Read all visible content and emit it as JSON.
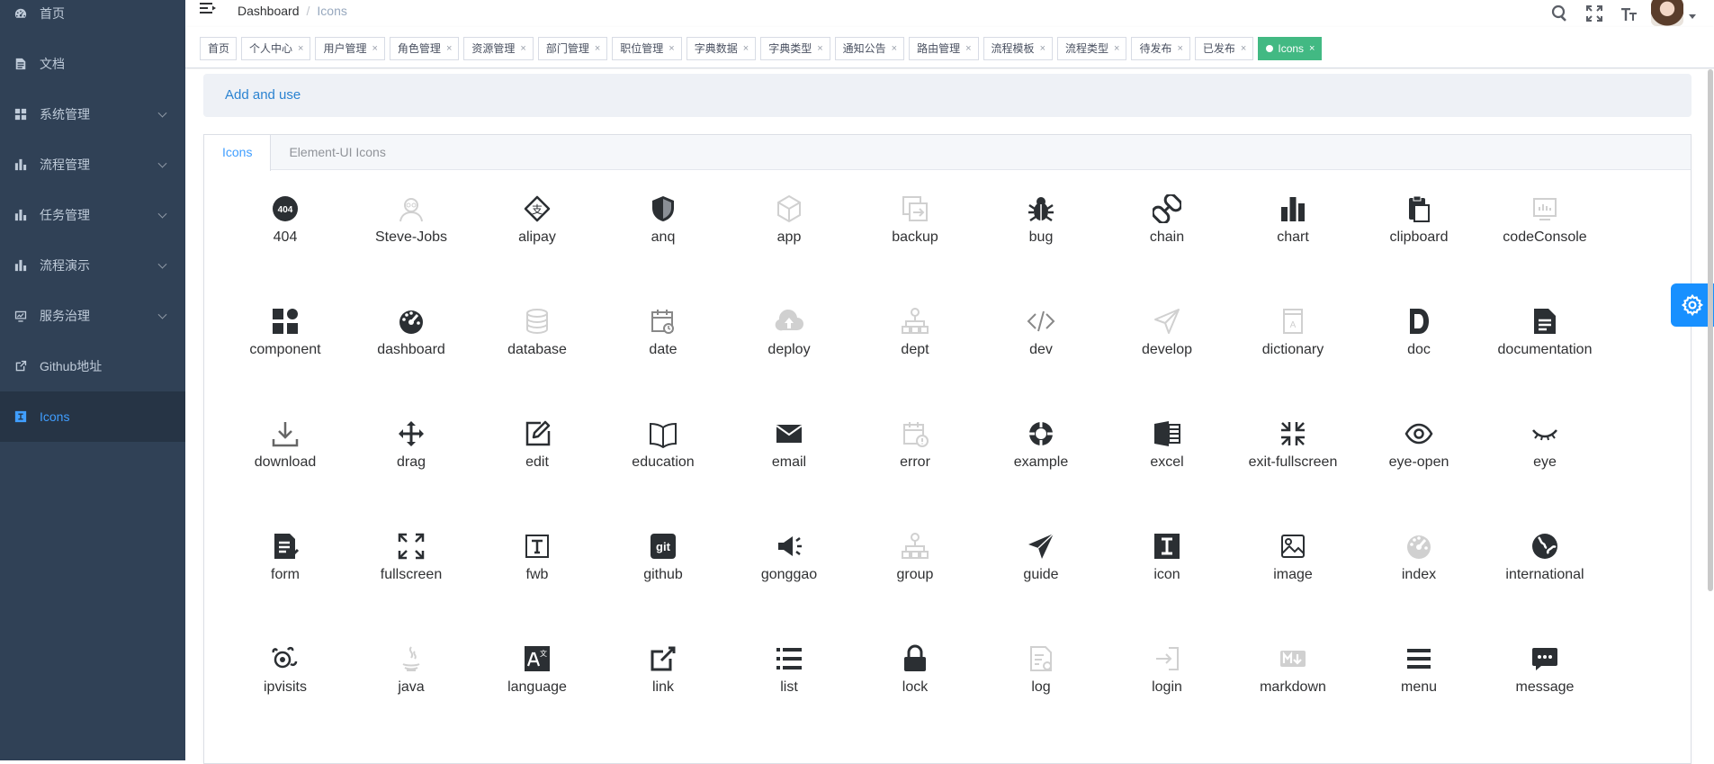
{
  "sidebar": {
    "items": [
      {
        "label": "首页",
        "icon": "dashboard-icon",
        "submenu": false
      },
      {
        "label": "文档",
        "icon": "document-icon",
        "submenu": false
      },
      {
        "label": "系统管理",
        "icon": "grid-icon",
        "submenu": true
      },
      {
        "label": "流程管理",
        "icon": "chart-icon",
        "submenu": true
      },
      {
        "label": "任务管理",
        "icon": "chart-icon",
        "submenu": true
      },
      {
        "label": "流程演示",
        "icon": "chart-icon",
        "submenu": true
      },
      {
        "label": "服务治理",
        "icon": "monitor-icon",
        "submenu": true
      },
      {
        "label": "Github地址",
        "icon": "external-link-icon",
        "submenu": false
      },
      {
        "label": "Icons",
        "icon": "icon-icon",
        "submenu": false,
        "active": true
      }
    ]
  },
  "breadcrumb": {
    "root": "Dashboard",
    "sep": "/",
    "current": "Icons"
  },
  "tags": [
    "首页",
    "个人中心",
    "用户管理",
    "角色管理",
    "资源管理",
    "部门管理",
    "职位管理",
    "字典数据",
    "字典类型",
    "通知公告",
    "路由管理",
    "流程模板",
    "流程类型",
    "待发布",
    "已发布",
    "Icons"
  ],
  "tags_close": "×",
  "banner": "Add and use",
  "tabs": [
    "Icons",
    "Element-UI Icons"
  ],
  "icons": [
    "404",
    "Steve-Jobs",
    "alipay",
    "anq",
    "app",
    "backup",
    "bug",
    "chain",
    "chart",
    "clipboard",
    "codeConsole",
    "component",
    "dashboard",
    "database",
    "date",
    "deploy",
    "dept",
    "dev",
    "develop",
    "dictionary",
    "doc",
    "documentation",
    "download",
    "drag",
    "edit",
    "education",
    "email",
    "error",
    "example",
    "excel",
    "exit-fullscreen",
    "eye-open",
    "eye",
    "form",
    "fullscreen",
    "fwb",
    "github",
    "gonggao",
    "group",
    "guide",
    "icon",
    "image",
    "index",
    "international",
    "ipvisits",
    "java",
    "language",
    "link",
    "list",
    "lock",
    "log",
    "login",
    "markdown",
    "menu",
    "message"
  ],
  "colors": {
    "sidebar_bg": "#304156",
    "active_blue": "#409eff",
    "tag_active": "#42b983",
    "settings_btn": "#1890ff"
  }
}
